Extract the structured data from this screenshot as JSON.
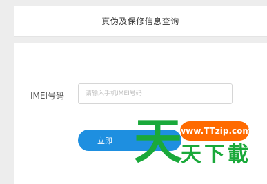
{
  "header": {
    "title": "真伪及保修信息查询"
  },
  "form": {
    "imei_label": "IMEI号码",
    "imei_placeholder": "请输入手机IMEI号码",
    "imei_value": "",
    "submit_label": "立即"
  },
  "watermark": {
    "big_char": "天",
    "url": "www.TTzip.com",
    "tail": "天下載"
  },
  "colors": {
    "page_bg": "#ededed",
    "button": "#1e8fe0",
    "watermark_green": "#1aa93a",
    "watermark_orange": "#ff6a00"
  }
}
